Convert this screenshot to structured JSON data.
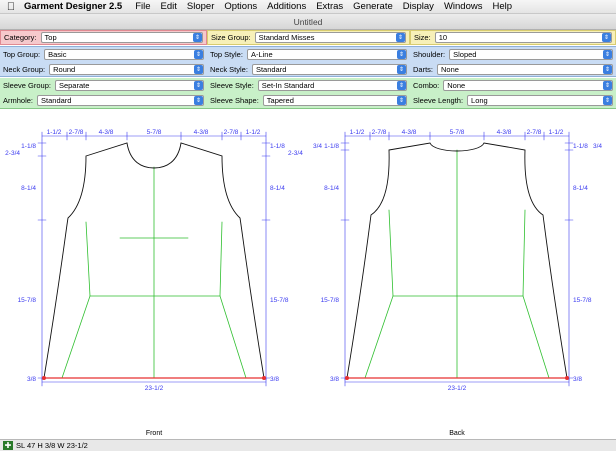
{
  "menubar": {
    "apple": "",
    "app_name": "Garment Designer 2.5",
    "items": [
      "File",
      "Edit",
      "Sloper",
      "Options",
      "Additions",
      "Extras",
      "Generate",
      "Display",
      "Windows",
      "Help"
    ]
  },
  "window": {
    "title": "Untitled"
  },
  "controls": {
    "category": {
      "label": "Category:",
      "value": "Top"
    },
    "size_group": {
      "label": "Size Group:",
      "value": "Standard Misses"
    },
    "size": {
      "label": "Size:",
      "value": "10"
    },
    "top_group": {
      "label": "Top Group:",
      "value": "Basic"
    },
    "top_style": {
      "label": "Top Style:",
      "value": "A-Line"
    },
    "shoulder": {
      "label": "Shoulder:",
      "value": "Sloped"
    },
    "neck_group": {
      "label": "Neck Group:",
      "value": "Round"
    },
    "neck_style": {
      "label": "Neck Style:",
      "value": "Standard"
    },
    "darts": {
      "label": "Darts:",
      "value": "None"
    },
    "sleeve_group": {
      "label": "Sleeve Group:",
      "value": "Separate"
    },
    "sleeve_style": {
      "label": "Sleeve Style:",
      "value": "Set-In Standard"
    },
    "combo": {
      "label": "Combo:",
      "value": "None"
    },
    "armhole": {
      "label": "Armhole:",
      "value": "Standard"
    },
    "sleeve_shape": {
      "label": "Sleeve Shape:",
      "value": "Tapered"
    },
    "sleeve_length": {
      "label": "Sleeve Length:",
      "value": "Long"
    }
  },
  "pattern": {
    "front": {
      "label": "Front",
      "top_dims": [
        "1-1/2",
        "2-7/8",
        "4-3/8",
        "5-7/8",
        "4-3/8",
        "2-7/8",
        "1-1/2"
      ],
      "left_dims": [
        "1-1/8",
        "2-3/4",
        "8-1/4",
        "15-7/8",
        "3/8"
      ],
      "right_dims": [
        "1-1/8",
        "2-3/4",
        "8-1/4",
        "15-7/8",
        "3/8"
      ],
      "bottom_dim": "23-1/2"
    },
    "back": {
      "label": "Back",
      "top_dims": [
        "1-1/2",
        "2-7/8",
        "4-3/8",
        "5-7/8",
        "4-3/8",
        "2-7/8",
        "1-1/2"
      ],
      "left_dims": [
        "1-1/8",
        "3/4",
        "8-1/4",
        "15-7/8",
        "3/8"
      ],
      "right_dims": [
        "1-1/8",
        "3/4",
        "8-1/4",
        "15-7/8",
        "3/8"
      ],
      "bottom_dim": "23-1/2"
    }
  },
  "statusbar": {
    "text": "SL 47  H 3/8  W 23-1/2"
  },
  "colors": {
    "dim": "#3a3af0",
    "guide": "#2fbf2f",
    "hem": "#e83030",
    "outline": "#111111",
    "row_pink": "#f6c9cc",
    "row_yellow": "#f7f0b8",
    "row_blue": "#c9dcf4",
    "row_green": "#c8f0c8"
  }
}
